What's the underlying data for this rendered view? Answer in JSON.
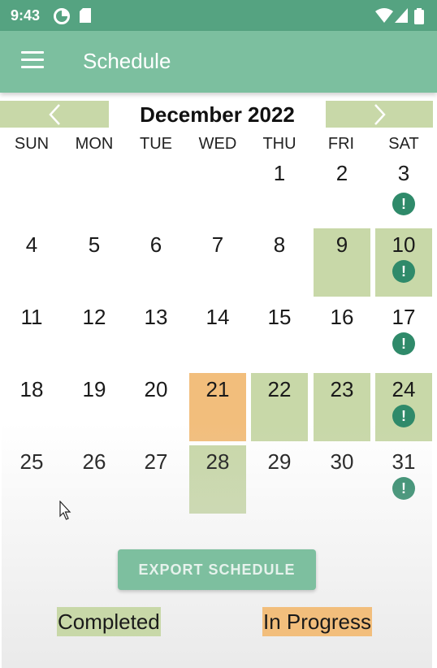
{
  "status_bar": {
    "time": "9:43",
    "icons": [
      "data-saver-icon",
      "sd-card-icon",
      "wifi-icon",
      "signal-icon",
      "battery-icon"
    ]
  },
  "app_bar": {
    "title": "Schedule",
    "menu_icon": "hamburger-menu-icon"
  },
  "calendar": {
    "month_title": "December 2022",
    "prev_icon": "chevron-left-icon",
    "next_icon": "chevron-right-icon",
    "weekdays": [
      "SUN",
      "MON",
      "TUE",
      "WED",
      "THU",
      "FRI",
      "SAT"
    ],
    "alert_symbol": "!",
    "days": [
      {
        "num": "1",
        "status": "none",
        "alert": false
      },
      {
        "num": "2",
        "status": "none",
        "alert": false
      },
      {
        "num": "3",
        "status": "none",
        "alert": true
      },
      {
        "num": "4",
        "status": "none",
        "alert": false
      },
      {
        "num": "5",
        "status": "none",
        "alert": false
      },
      {
        "num": "6",
        "status": "none",
        "alert": false
      },
      {
        "num": "7",
        "status": "none",
        "alert": false
      },
      {
        "num": "8",
        "status": "none",
        "alert": false
      },
      {
        "num": "9",
        "status": "completed",
        "alert": false
      },
      {
        "num": "10",
        "status": "completed",
        "alert": true
      },
      {
        "num": "11",
        "status": "none",
        "alert": false
      },
      {
        "num": "12",
        "status": "none",
        "alert": false
      },
      {
        "num": "13",
        "status": "none",
        "alert": false
      },
      {
        "num": "14",
        "status": "none",
        "alert": false
      },
      {
        "num": "15",
        "status": "none",
        "alert": false
      },
      {
        "num": "16",
        "status": "none",
        "alert": false
      },
      {
        "num": "17",
        "status": "none",
        "alert": true
      },
      {
        "num": "18",
        "status": "none",
        "alert": false
      },
      {
        "num": "19",
        "status": "none",
        "alert": false
      },
      {
        "num": "20",
        "status": "none",
        "alert": false
      },
      {
        "num": "21",
        "status": "in_progress",
        "alert": false
      },
      {
        "num": "22",
        "status": "completed",
        "alert": false
      },
      {
        "num": "23",
        "status": "completed",
        "alert": false
      },
      {
        "num": "24",
        "status": "completed",
        "alert": true
      },
      {
        "num": "25",
        "status": "none",
        "alert": false
      },
      {
        "num": "26",
        "status": "none",
        "alert": false
      },
      {
        "num": "27",
        "status": "none",
        "alert": false
      },
      {
        "num": "28",
        "status": "completed",
        "alert": false
      },
      {
        "num": "29",
        "status": "none",
        "alert": false
      },
      {
        "num": "30",
        "status": "none",
        "alert": false
      },
      {
        "num": "31",
        "status": "none",
        "alert": true
      }
    ]
  },
  "export_button": {
    "label": "EXPORT SCHEDULE"
  },
  "legend": {
    "completed": "Completed",
    "in_progress": "In Progress"
  },
  "colors": {
    "status_bar": "#55a381",
    "app_bar": "#7cbf9f",
    "completed": "#c8d8a8",
    "in_progress": "#f2be7c",
    "alert": "#2f8a6a"
  }
}
